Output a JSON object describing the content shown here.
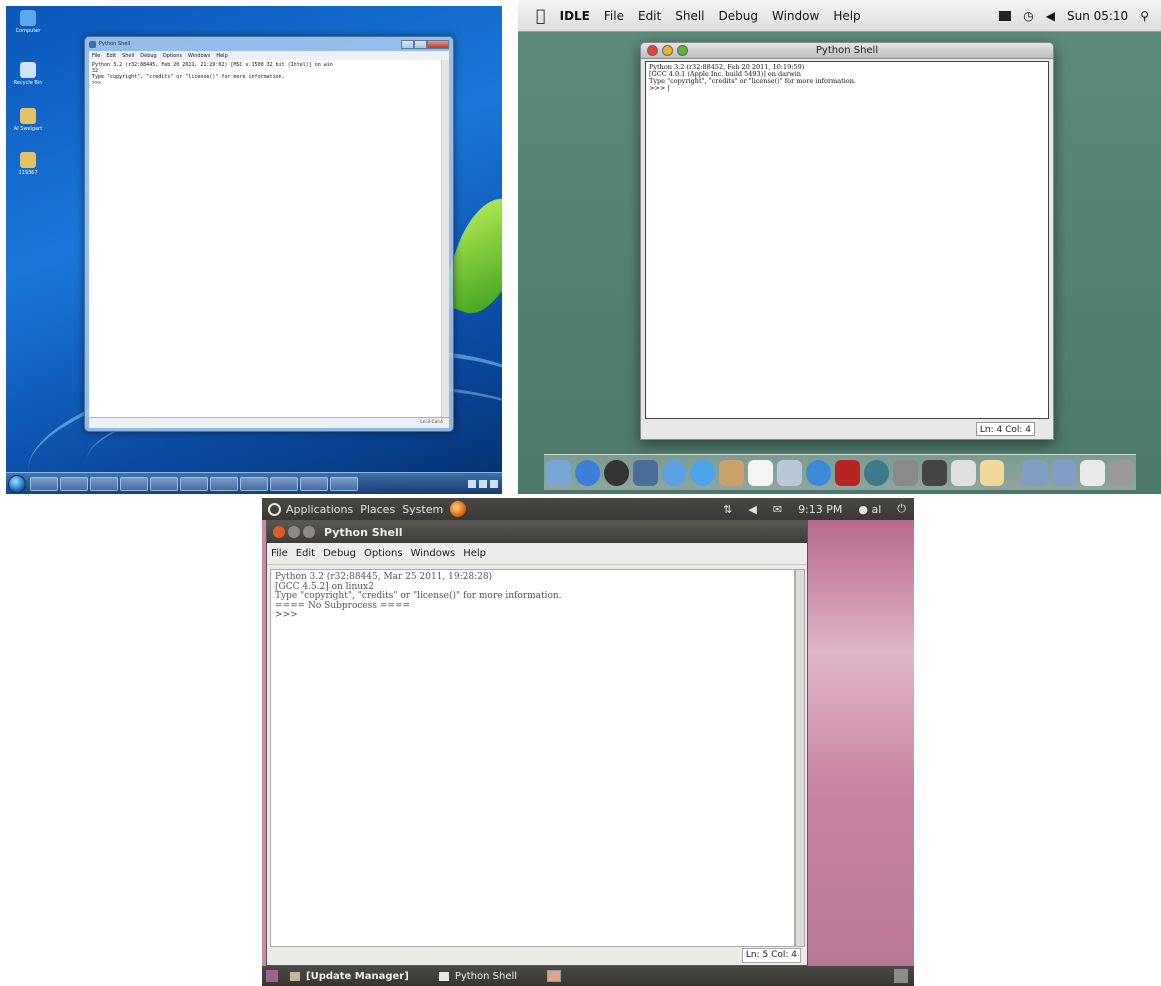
{
  "win7": {
    "desktop_icons": [
      "Computer",
      "Recycle Bin",
      "Al Sweigart",
      "119367"
    ],
    "window_title": "Python Shell",
    "menu": [
      "File",
      "Edit",
      "Shell",
      "Debug",
      "Options",
      "Windows",
      "Help"
    ],
    "lines": [
      "Python 3.2 (r32:88445, Feb 20 2011, 21:29:02) [MSC v.1500 32 bit (Intel)] on win",
      "32",
      "Type \"copyright\", \"credits\" or \"license()\" for more information.",
      ">>>"
    ],
    "status": "Ln:3 Col:4"
  },
  "mac": {
    "menubar": {
      "app": "IDLE",
      "items": [
        "File",
        "Edit",
        "Shell",
        "Debug",
        "Window",
        "Help"
      ],
      "clock": "Sun 05:10"
    },
    "window_title": "Python Shell",
    "lines": [
      "Python 3.2 (r32:88452, Feb 20 2011, 10:19:59)",
      "[GCC 4.0.1 (Apple Inc. build 5493)] on darwin",
      "Type \"copyright\", \"credits\" or \"license()\" for more information.",
      ">>> |"
    ],
    "status": "Ln: 4 Col: 4"
  },
  "ubuntu": {
    "top_panel": {
      "items": [
        "Applications",
        "Places",
        "System"
      ],
      "clock": "9:13 PM",
      "user": "al"
    },
    "window_title": "Python Shell",
    "menu": [
      "File",
      "Edit",
      "Debug",
      "Options",
      "Windows",
      "Help"
    ],
    "lines": [
      "Python 3.2 (r32:88445, Mar 25 2011, 19:28:28)",
      "[GCC 4.5.2] on linux2",
      "Type \"copyright\", \"credits\" or \"license()\" for more information.",
      "==== No Subprocess ====",
      ">>>"
    ],
    "status": "Ln: 5 Col: 4",
    "taskbar": [
      "[Update Manager]",
      "Python Shell"
    ]
  },
  "colors": {
    "win7_bg": "#1a78d8",
    "mac_bg": "#5e8c7c",
    "ubuntu_panel": "#3a3835",
    "ubuntu_close": "#e0592a"
  }
}
